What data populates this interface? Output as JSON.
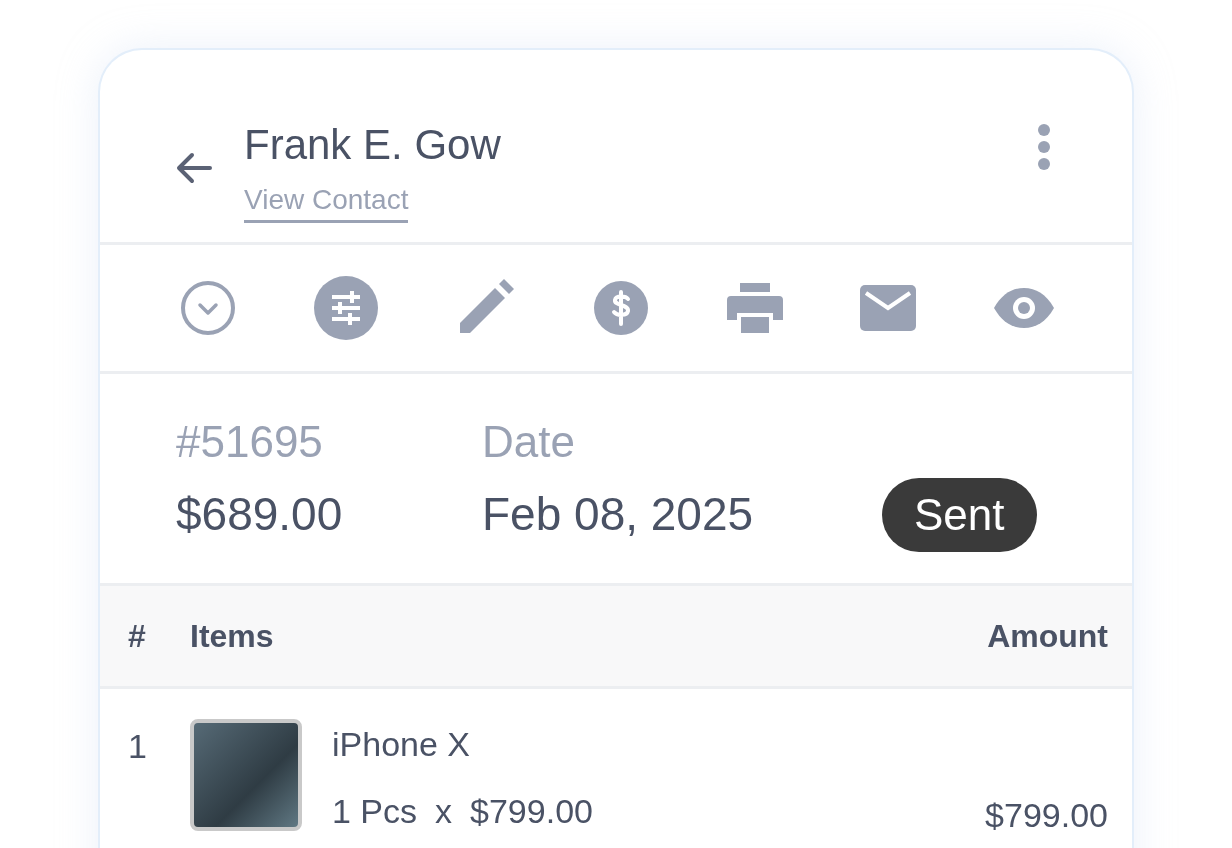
{
  "contact": {
    "name": "Frank E. Gow",
    "link": "View Contact"
  },
  "invoice": {
    "number_label": "#51695",
    "amount": "$689.00",
    "date_label": "Date",
    "date": "Feb 08, 2025",
    "status": "Sent"
  },
  "table": {
    "columns": [
      "#",
      "Items",
      "Amount"
    ],
    "rows": [
      {
        "index": "1",
        "name": "iPhone X",
        "quantity": "1 Pcs",
        "times": "x",
        "price": "$799.00",
        "amount": "$799.00"
      }
    ]
  }
}
